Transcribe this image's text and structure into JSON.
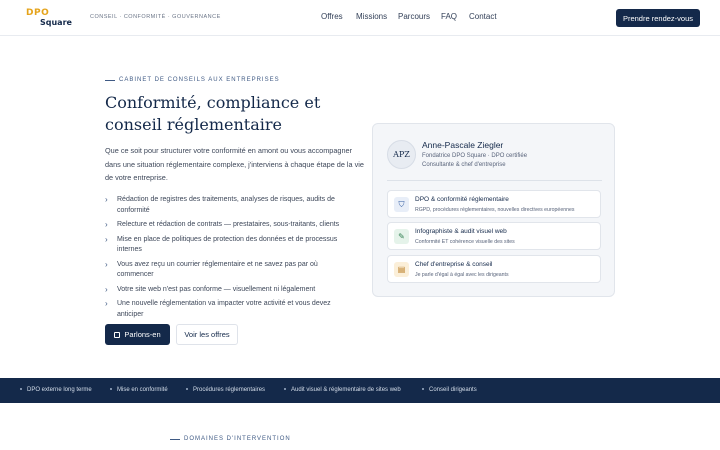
{
  "header": {
    "logo_line1": "DPO",
    "logo_line2": "Square",
    "tagline": "Conseil · Conformité · Gouvernance",
    "nav": [
      "Offres",
      "Missions",
      "Parcours",
      "FAQ",
      "Contact"
    ],
    "cta_label": "Prendre rendez-vous"
  },
  "hero": {
    "eyebrow": "Cabinet de conseils aux entreprises",
    "title_line1": "Conformité, compliance et",
    "title_line2": "conseil réglementaire",
    "intro": "Que ce soit pour structurer votre conformité en amont ou vous accompagner dans une situation réglementaire complexe, j'interviens à chaque étape de la vie de votre entreprise.",
    "bullets": [
      "Rédaction de registres des traitements, analyses de risques, audits de conformité",
      "Relecture et rédaction de contrats — prestataires, sous-traitants, clients",
      "Mise en place de politiques de protection des données et de processus internes",
      "Vous avez reçu un courrier réglementaire et ne savez pas par où commencer",
      "Votre site web n'est pas conforme — visuellement ni légalement",
      "Une nouvelle réglementation va impacter votre activité et vous devez anticiper"
    ],
    "primary_button": "Parlons-en",
    "secondary_button": "Voir les offres"
  },
  "profile": {
    "initials": "APZ",
    "name": "Anne-Pascale Ziegler",
    "role_line1": "Fondatrice DPO Square · DPO certifiée",
    "role_line2": "Consultante & chef d'entreprise",
    "services": [
      {
        "title": "DPO & conformité réglementaire",
        "desc": "RGPD, procédures réglementaires, nouvelles directives européennes",
        "icon": "shield-icon",
        "color": "#2f5aa0",
        "bg": "#e8eef8"
      },
      {
        "title": "Infographiste & audit visuel web",
        "desc": "Conformité ET cohérence visuelle des sites",
        "icon": "pen-icon",
        "color": "#2e7d4f",
        "bg": "#e5f3ea"
      },
      {
        "title": "Chef d'entreprise & conseil",
        "desc": "Je parle d'égal à égal avec les dirigeants",
        "icon": "briefcase-icon",
        "color": "#b7791f",
        "bg": "#fbefd9"
      }
    ]
  },
  "band": {
    "items": [
      "DPO externe long terme",
      "Mise en conformité",
      "Procédures réglementaires",
      "Audit visuel & réglementaire de sites web",
      "Conseil dirigeants"
    ]
  },
  "section": {
    "domains_label": "Domaines d'intervention"
  }
}
